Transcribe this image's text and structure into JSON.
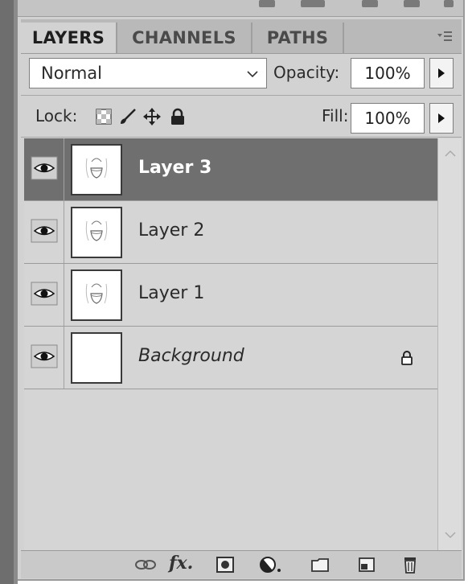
{
  "tabs": [
    {
      "label": "LAYERS",
      "active": true
    },
    {
      "label": "CHANNELS",
      "active": false
    },
    {
      "label": "PATHS",
      "active": false
    }
  ],
  "blend_mode": {
    "selected": "Normal"
  },
  "opacity": {
    "label": "Opacity:",
    "value": "100%"
  },
  "lock": {
    "label": "Lock:",
    "icons": [
      "lock-transparent-icon",
      "lock-paint-icon",
      "lock-move-icon",
      "lock-all-icon"
    ]
  },
  "fill": {
    "label": "Fill:",
    "value": "100%"
  },
  "layers": [
    {
      "name": "Layer 3",
      "selected": true,
      "visible": true,
      "thumbnail": "drawing"
    },
    {
      "name": "Layer 2",
      "selected": false,
      "visible": true,
      "thumbnail": "drawing"
    },
    {
      "name": "Layer 1",
      "selected": false,
      "visible": true,
      "thumbnail": "drawing"
    },
    {
      "name": "Background",
      "selected": false,
      "visible": true,
      "thumbnail": "blank",
      "locked": true
    }
  ],
  "bottom_icons": [
    "link-layers-icon",
    "fx-icon",
    "add-mask-icon",
    "adjustment-layer-icon",
    "new-group-icon",
    "new-layer-icon",
    "trash-icon"
  ],
  "colors": {
    "panel": "#d2d2d2",
    "selected_row": "#6f6f6f",
    "tab_bar": "#b9b9b9"
  }
}
